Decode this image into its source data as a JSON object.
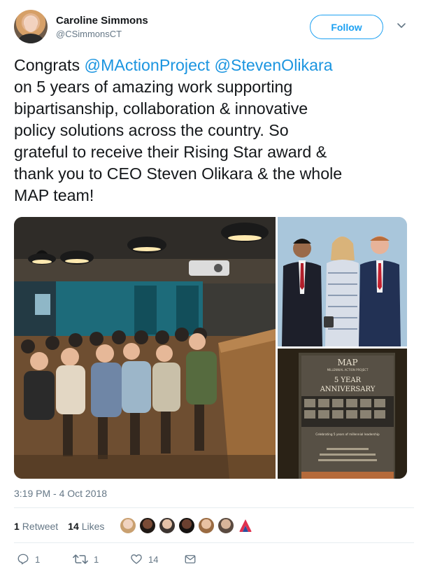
{
  "user": {
    "display_name": "Caroline Simmons",
    "handle": "@CSimmonsCT",
    "follow_label": "Follow"
  },
  "tweet": {
    "lines": [
      {
        "before": "Congrats ",
        "mention1": "@MActionProject",
        "between": " ",
        "mention2": "@StevenOlikara"
      },
      {
        "text": "on 5 years of amazing work supporting"
      },
      {
        "text": "bipartisanship, collaboration & innovative"
      },
      {
        "text": "policy solutions across the country. So"
      },
      {
        "text": "grateful to receive their Rising Star award &"
      },
      {
        "text": "thank you to CEO Steven Olikara & the whole"
      },
      {
        "text": "MAP team!"
      }
    ]
  },
  "media": {
    "photos": [
      "event-audience-photo",
      "award-presentation-photo",
      "anniversary-program-photo"
    ],
    "program_text": {
      "logo": "MAP",
      "org": "MILLENNIAL ACTION PROJECT",
      "title_line1": "5 YEAR",
      "title_line2": "ANNIVERSARY",
      "subtitle": "Celebrating 5 years of millennial leadership"
    }
  },
  "timestamp": "3:19 PM - 4 Oct 2018",
  "stats": {
    "retweets_count": "1",
    "retweets_label": "Retweet",
    "likes_count": "14",
    "likes_label": "Likes",
    "liker_colors": [
      "#e8b08f",
      "#3b2a22",
      "#c9a184",
      "#2e2420",
      "#d8a374",
      "#9b7e6a"
    ],
    "brand_color": "#e0314f"
  },
  "actions": {
    "reply_count": "1",
    "retweet_count": "1",
    "like_count": "14"
  },
  "colors": {
    "accent": "#1da1f2",
    "mention": "#1b95e0",
    "muted": "#657786"
  }
}
